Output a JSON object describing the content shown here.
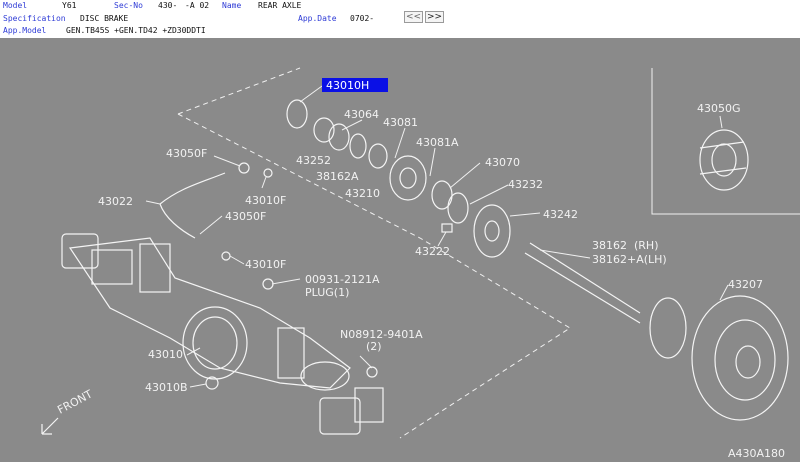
{
  "header": {
    "model_label": "Model",
    "model_value": "Y61",
    "secno_label": "Sec-No",
    "secno_value": "430-",
    "secno_suffix": "-A 02",
    "name_label": "Name",
    "name_value": "REAR AXLE",
    "spec_label": "Specification",
    "spec_value": "DISC BRAKE",
    "appdate_label": "App.Date",
    "appdate_value": "0702-",
    "appmodel_label": "App.Model",
    "appmodel_value": "GEN.TB45S +GEN.TD42 +ZD30DDTI",
    "prev_button": "<<",
    "next_button": ">>"
  },
  "diagram": {
    "highlighted_part": "43010H",
    "parts": {
      "p43010H": "43010H",
      "p43064": "43064",
      "p43081": "43081",
      "p43081A": "43081A",
      "p43070": "43070",
      "p43252": "43252",
      "p38162A": "38162A",
      "p43210": "43210",
      "p43232": "43232",
      "p43242": "43242",
      "p43050F_a": "43050F",
      "p43010F_a": "43010F",
      "p43022": "43022",
      "p43050F_b": "43050F",
      "p43222": "43222",
      "p38162_rh": "38162  (RH)",
      "p38162_lh": "38162+A(LH)",
      "p43010F_b": "43010F",
      "p00931": "00931-2121A",
      "plug": "PLUG(1)",
      "p43207": "43207",
      "p43050G": "43050G",
      "p43010": "43010",
      "p08912": "N08912-9401A",
      "p08912_qty": "(2)",
      "p43010B": "43010B",
      "front": "FRONT",
      "ref_code": "A430A180"
    }
  }
}
